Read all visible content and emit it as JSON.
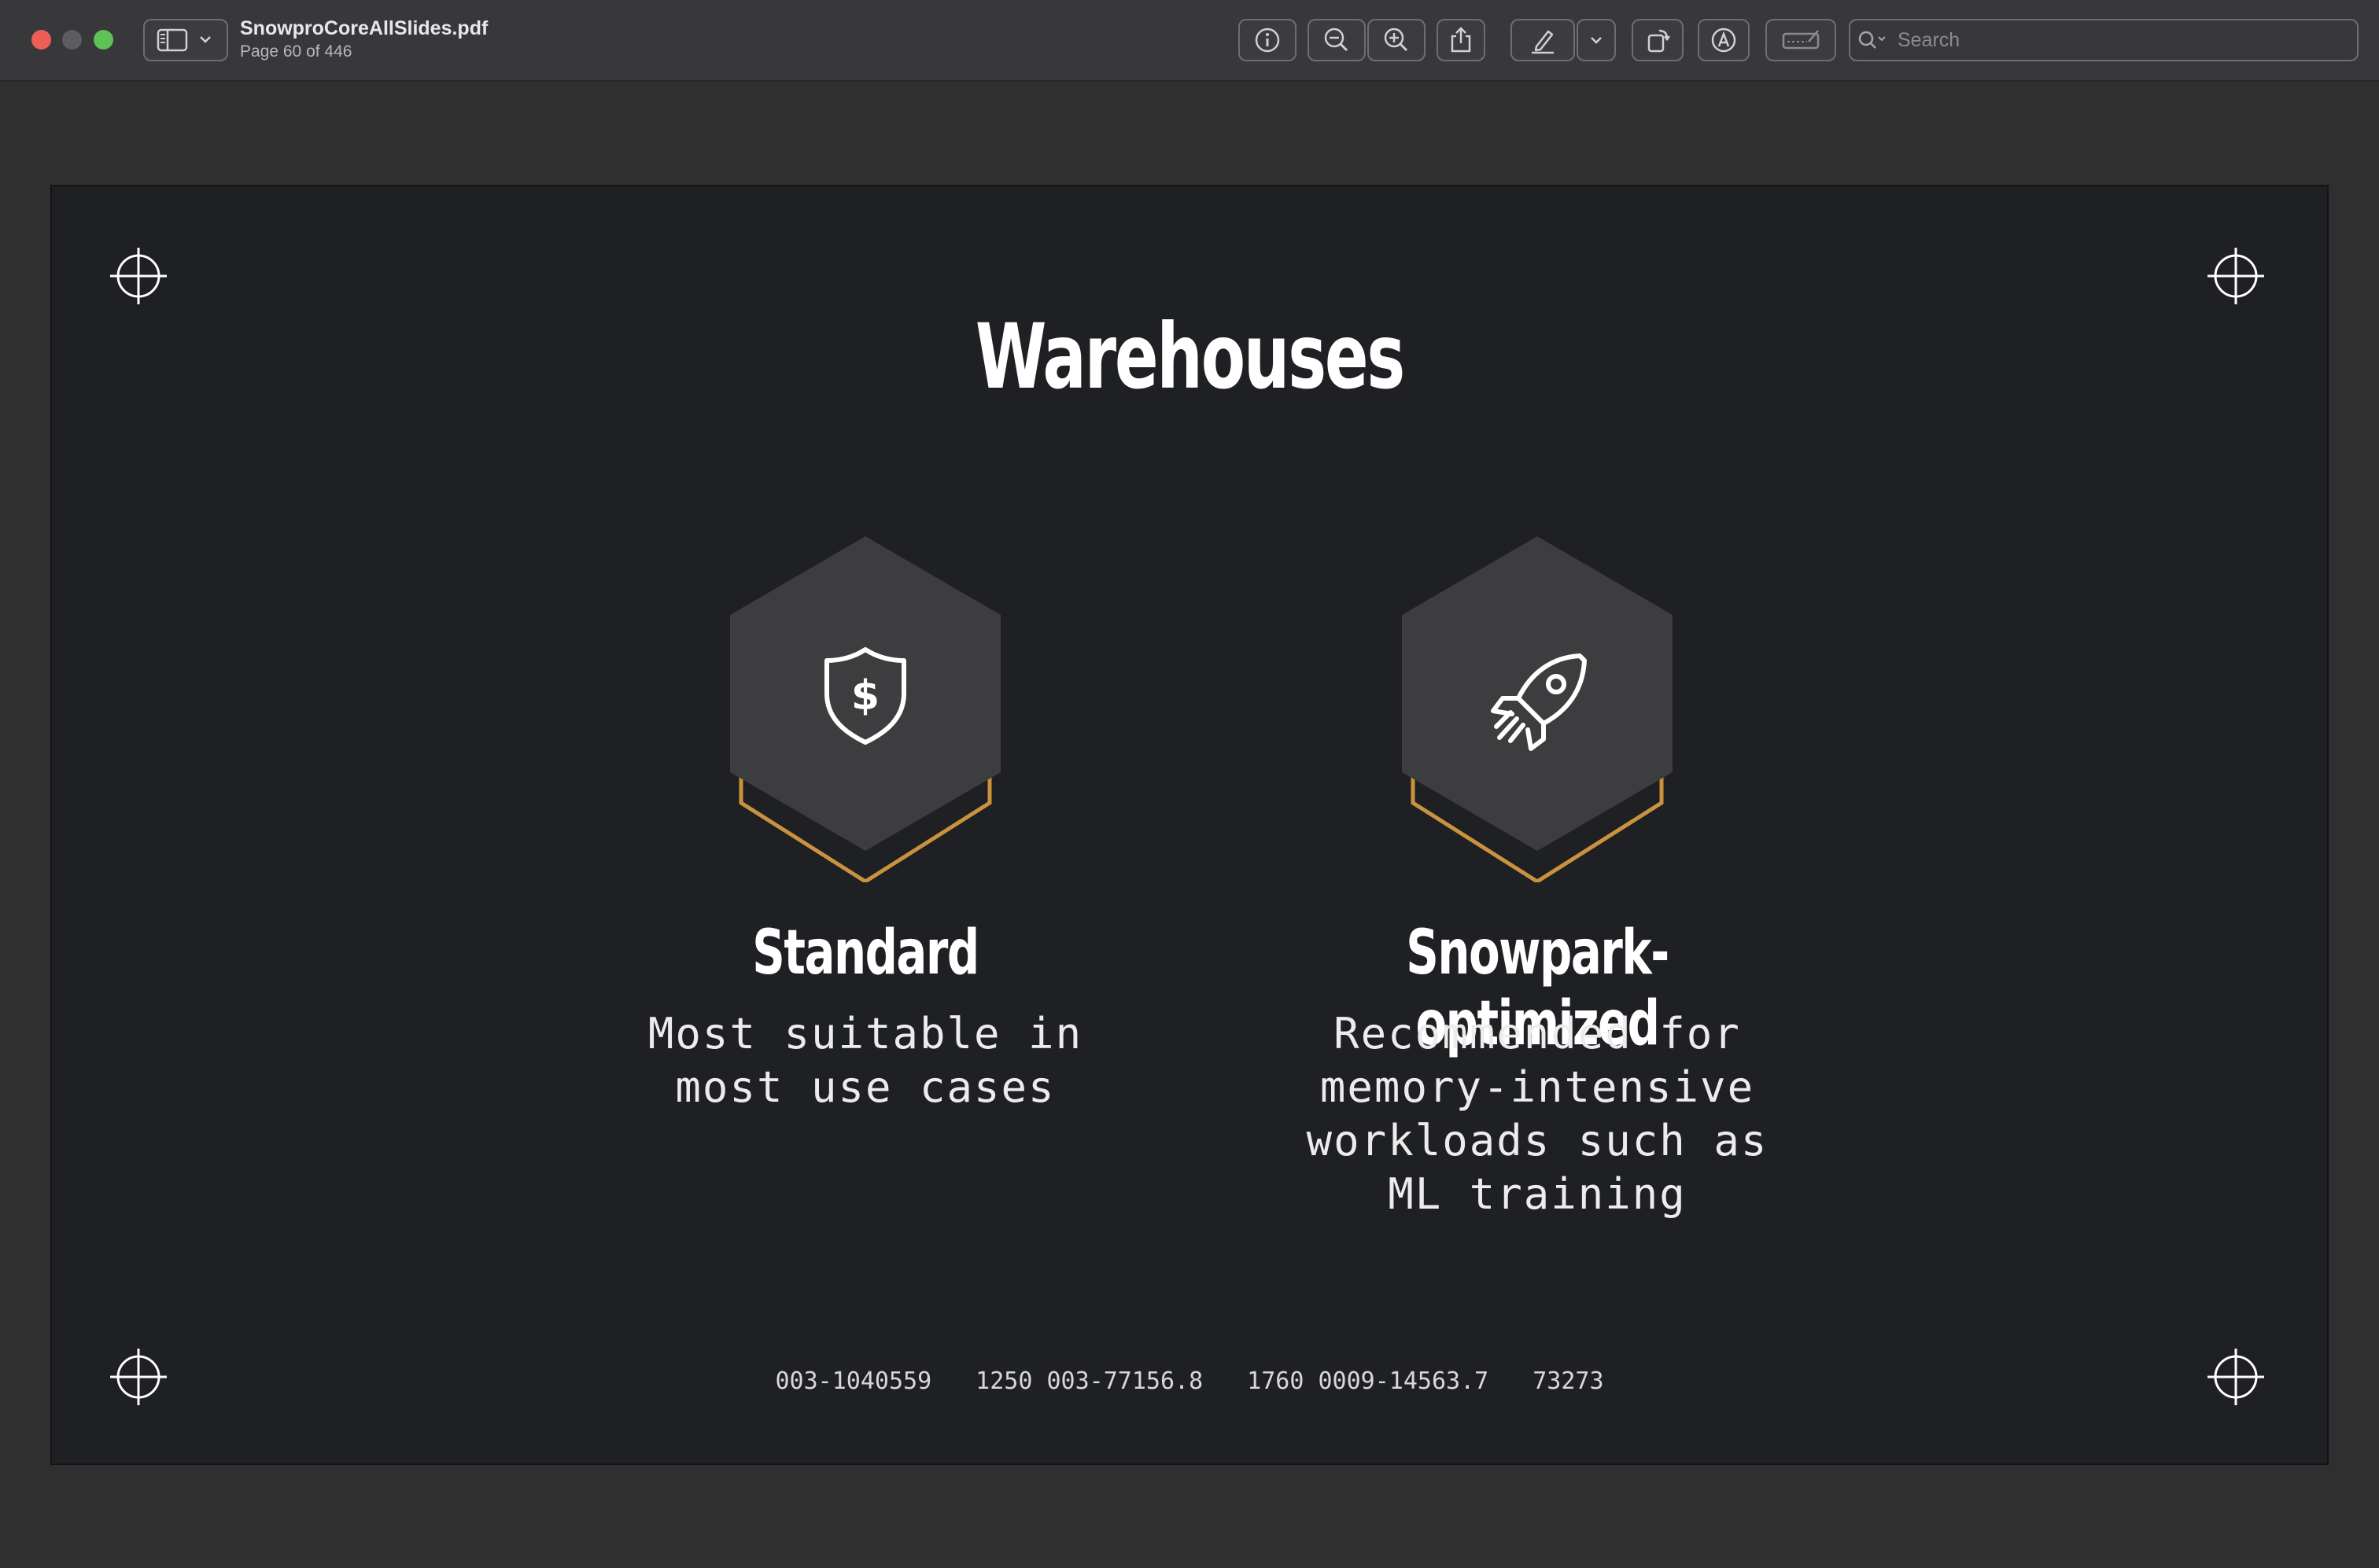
{
  "window": {
    "document_name": "SnowproCoreAllSlides.pdf",
    "page_indicator": "Page 60 of 446"
  },
  "toolbar": {
    "buttons": [
      {
        "icon": "sidebar-toggle-icon"
      },
      {
        "icon": "info-icon"
      },
      {
        "icon": "zoom-out-icon"
      },
      {
        "icon": "zoom-in-icon"
      },
      {
        "icon": "share-icon"
      },
      {
        "icon": "highlight-pen-icon"
      },
      {
        "icon": "chevron-down-icon"
      },
      {
        "icon": "rotate-icon"
      },
      {
        "icon": "markup-icon"
      },
      {
        "icon": "signature-icon"
      }
    ],
    "search_placeholder": "Search"
  },
  "slide": {
    "title": "Warehouses",
    "cards": [
      {
        "icon": "shield-dollar-icon",
        "heading": "Standard",
        "body": "Most suitable in\nmost use cases"
      },
      {
        "icon": "rocket-icon",
        "heading": "Snowpark-optimized",
        "body": "Recommended for\nmemory-intensive\nworkloads such as\nML training"
      }
    ],
    "footer_codes": [
      "003-1040559",
      "1250 003-77156.8",
      "1760 0009-14563.7",
      "73273"
    ]
  },
  "colors": {
    "slide_background": "#1f2024",
    "hexagon_fill": "#3d3d3f",
    "accent_gold": "#c9933e",
    "text_white": "#ffffff"
  }
}
